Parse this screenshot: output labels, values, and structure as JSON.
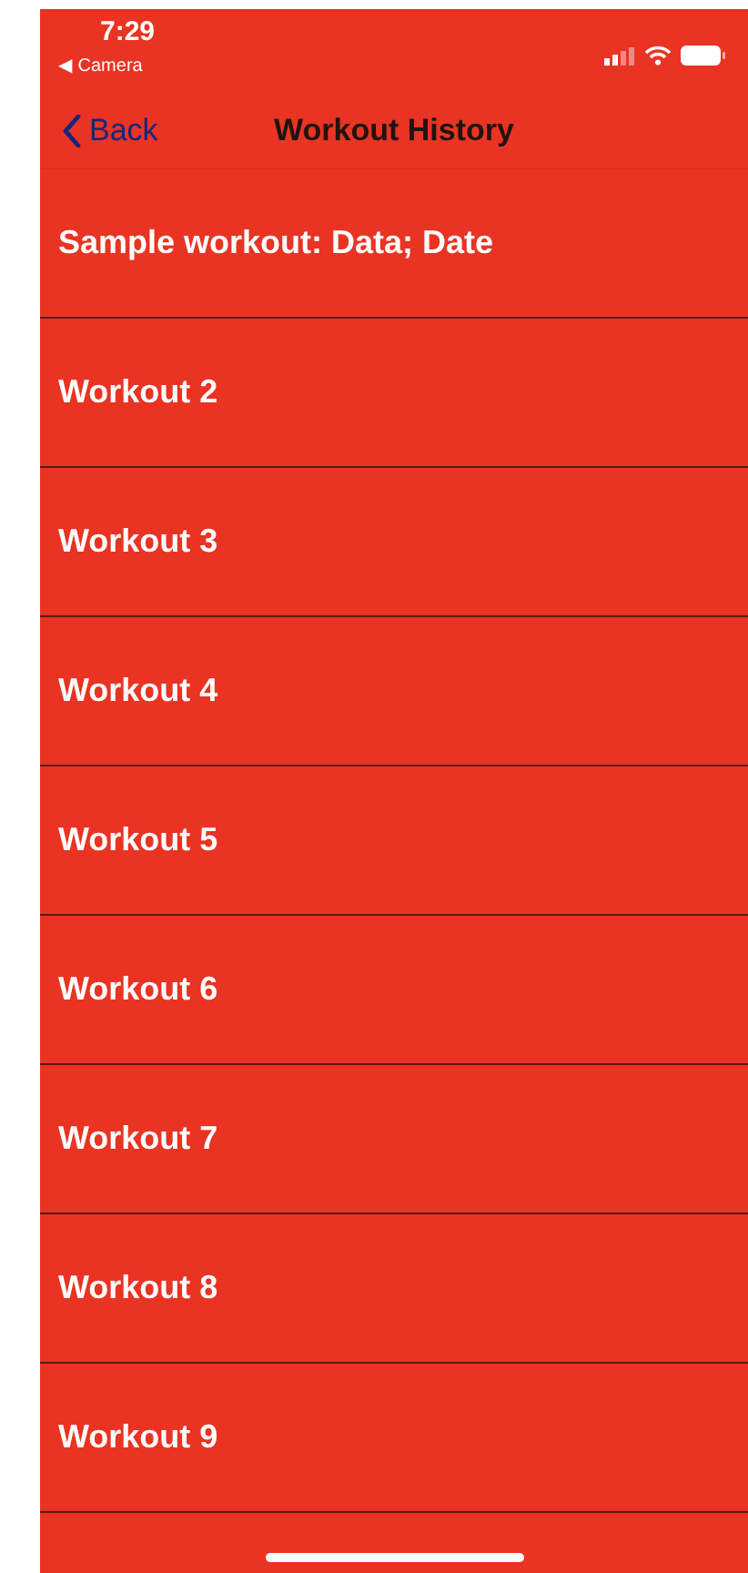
{
  "status_bar": {
    "time": "7:29",
    "back_app": "◀ Camera"
  },
  "nav": {
    "back": "Back",
    "title": "Workout History"
  },
  "workouts": [
    {
      "title": "Sample workout: Data; Date"
    },
    {
      "title": "Workout 2"
    },
    {
      "title": "Workout 3"
    },
    {
      "title": "Workout 4"
    },
    {
      "title": "Workout 5"
    },
    {
      "title": "Workout 6"
    },
    {
      "title": "Workout 7"
    },
    {
      "title": "Workout 8"
    },
    {
      "title": "Workout 9"
    }
  ]
}
